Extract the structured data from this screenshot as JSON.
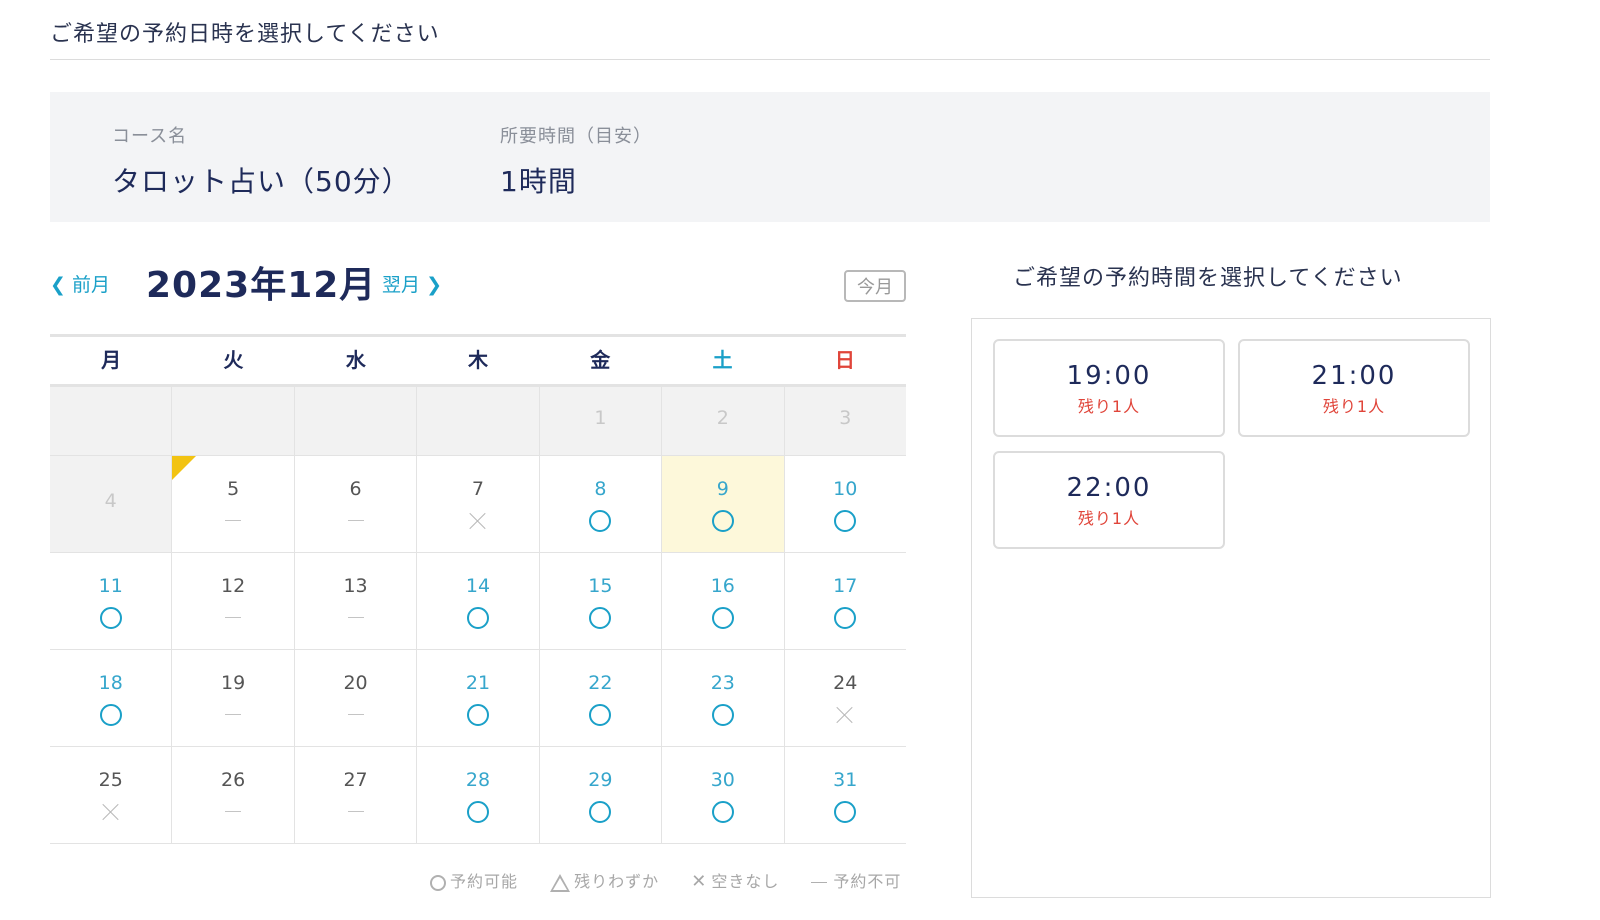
{
  "page_title": "ご希望の予約日時を選択してください",
  "course": {
    "name_label": "コース名",
    "name": "タロット占い（50分）",
    "duration_label": "所要時間（目安）",
    "duration": "1時間"
  },
  "calendar": {
    "prev_label": "前月",
    "next_label": "翌月",
    "month_title": "2023年12月",
    "today_label": "今月",
    "weekdays": [
      "月",
      "火",
      "水",
      "木",
      "金",
      "土",
      "日"
    ],
    "weeks": [
      [
        {
          "day": "",
          "state": "past"
        },
        {
          "day": "",
          "state": "past"
        },
        {
          "day": "",
          "state": "past"
        },
        {
          "day": "",
          "state": "past"
        },
        {
          "day": "1",
          "state": "past"
        },
        {
          "day": "2",
          "state": "past"
        },
        {
          "day": "3",
          "state": "past"
        }
      ],
      [
        {
          "day": "4",
          "state": "past"
        },
        {
          "day": "5",
          "state": "na"
        },
        {
          "day": "6",
          "state": "na"
        },
        {
          "day": "7",
          "state": "full"
        },
        {
          "day": "8",
          "state": "ok"
        },
        {
          "day": "9",
          "state": "ok-selected"
        },
        {
          "day": "10",
          "state": "ok"
        }
      ],
      [
        {
          "day": "11",
          "state": "ok"
        },
        {
          "day": "12",
          "state": "na"
        },
        {
          "day": "13",
          "state": "na"
        },
        {
          "day": "14",
          "state": "ok"
        },
        {
          "day": "15",
          "state": "ok"
        },
        {
          "day": "16",
          "state": "ok"
        },
        {
          "day": "17",
          "state": "ok"
        }
      ],
      [
        {
          "day": "18",
          "state": "ok"
        },
        {
          "day": "19",
          "state": "na"
        },
        {
          "day": "20",
          "state": "na"
        },
        {
          "day": "21",
          "state": "ok"
        },
        {
          "day": "22",
          "state": "ok"
        },
        {
          "day": "23",
          "state": "ok"
        },
        {
          "day": "24",
          "state": "full"
        }
      ],
      [
        {
          "day": "25",
          "state": "full"
        },
        {
          "day": "26",
          "state": "na"
        },
        {
          "day": "27",
          "state": "na"
        },
        {
          "day": "28",
          "state": "ok"
        },
        {
          "day": "29",
          "state": "ok"
        },
        {
          "day": "30",
          "state": "ok"
        },
        {
          "day": "31",
          "state": "ok"
        }
      ]
    ],
    "legend": {
      "available": "予約可能",
      "few": "残りわずか",
      "full": "空きなし",
      "unavailable": "予約不可"
    },
    "colors": {
      "accent": "#1aa0c8",
      "sunday": "#e0453a",
      "selected_bg": "#fdf8da",
      "today_marker": "#f2c312"
    }
  },
  "time_select": {
    "title": "ご希望の予約時間を選択してください",
    "slots": [
      {
        "time": "19:00",
        "remaining": "残り1人"
      },
      {
        "time": "21:00",
        "remaining": "残り1人"
      },
      {
        "time": "22:00",
        "remaining": "残り1人"
      }
    ]
  }
}
